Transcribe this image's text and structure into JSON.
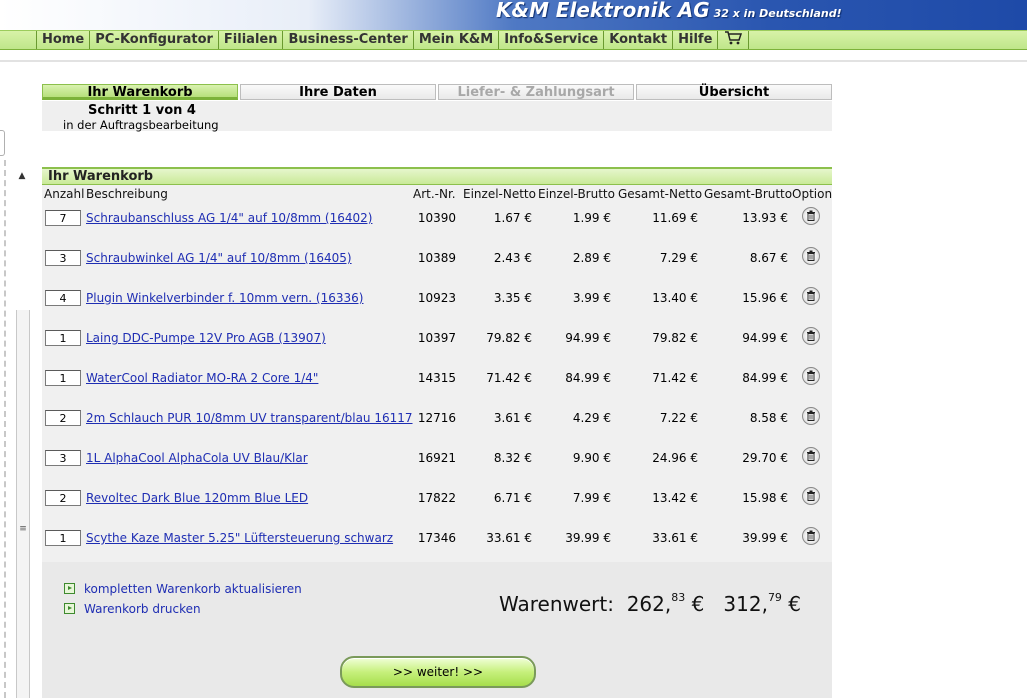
{
  "header": {
    "brand": "K&M Elektronik AG",
    "tagline": "32 x in Deutschland!"
  },
  "nav": {
    "items": [
      "Home",
      "PC-Konfigurator",
      "Filialen",
      "Business-Center",
      "Mein K&M",
      "Info&Service",
      "Kontakt",
      "Hilfe"
    ],
    "cart_icon": "shopping-cart-icon"
  },
  "steps": {
    "tabs": [
      "Ihr Warenkorb",
      "Ihre Daten",
      "Liefer- & Zahlungsart",
      "Übersicht"
    ],
    "step_text": "Schritt 1 von 4",
    "step_sub": "in der Auftragsbearbeitung"
  },
  "cart": {
    "title": "Ihr Warenkorb",
    "columns": [
      "Anzahl",
      "Beschreibung",
      "Art.-Nr.",
      "Einzel-Netto",
      "Einzel-Brutto",
      "Gesamt-Netto",
      "Gesamt-Brutto",
      "Option"
    ],
    "rows": [
      {
        "qty": "7",
        "desc": "Schraubanschluss AG 1/4\" auf 10/8mm (16402)",
        "art": "10390",
        "en": "1.67 €",
        "eb": "1.99 €",
        "gn": "11.69 €",
        "gb": "13.93 €"
      },
      {
        "qty": "3",
        "desc": "Schraubwinkel AG 1/4\" auf 10/8mm (16405)",
        "art": "10389",
        "en": "2.43 €",
        "eb": "2.89 €",
        "gn": "7.29 €",
        "gb": "8.67 €"
      },
      {
        "qty": "4",
        "desc": "Plugin Winkelverbinder f. 10mm vern. (16336)",
        "art": "10923",
        "en": "3.35 €",
        "eb": "3.99 €",
        "gn": "13.40 €",
        "gb": "15.96 €"
      },
      {
        "qty": "1",
        "desc": "Laing DDC-Pumpe 12V Pro AGB (13907)",
        "art": "10397",
        "en": "79.82 €",
        "eb": "94.99 €",
        "gn": "79.82 €",
        "gb": "94.99 €"
      },
      {
        "qty": "1",
        "desc": "WaterCool Radiator MO-RA 2 Core 1/4\"",
        "art": "14315",
        "en": "71.42 €",
        "eb": "84.99 €",
        "gn": "71.42 €",
        "gb": "84.99 €"
      },
      {
        "qty": "2",
        "desc": "2m Schlauch PUR 10/8mm UV transparent/blau 16117",
        "art": "12716",
        "en": "3.61 €",
        "eb": "4.29 €",
        "gn": "7.22 €",
        "gb": "8.58 €"
      },
      {
        "qty": "3",
        "desc": "1L AlphaCool AlphaCola UV Blau/Klar",
        "art": "16921",
        "en": "8.32 €",
        "eb": "9.90 €",
        "gn": "24.96 €",
        "gb": "29.70 €"
      },
      {
        "qty": "2",
        "desc": "Revoltec Dark Blue 120mm Blue LED",
        "art": "17822",
        "en": "6.71 €",
        "eb": "7.99 €",
        "gn": "13.42 €",
        "gb": "15.98 €"
      },
      {
        "qty": "1",
        "desc": "Scythe Kaze Master 5.25\" Lüftersteuerung schwarz",
        "art": "17346",
        "en": "33.61 €",
        "eb": "39.99 €",
        "gn": "33.61 €",
        "gb": "39.99 €"
      }
    ],
    "delete_icon": "trash-icon"
  },
  "actions": {
    "update": "kompletten Warenkorb aktualisieren",
    "print": "Warenkorb drucken",
    "next": ">> weiter! >>"
  },
  "totals": {
    "label": "Warenwert:",
    "netto_main": "262,",
    "netto_cents": "83",
    "brutto_main": "312,",
    "brutto_cents": "79",
    "currency": "€"
  },
  "colors": {
    "accent_green": "#b7e07c",
    "link_blue": "#1f2eb3",
    "banner_blue": "#2a56b0"
  }
}
